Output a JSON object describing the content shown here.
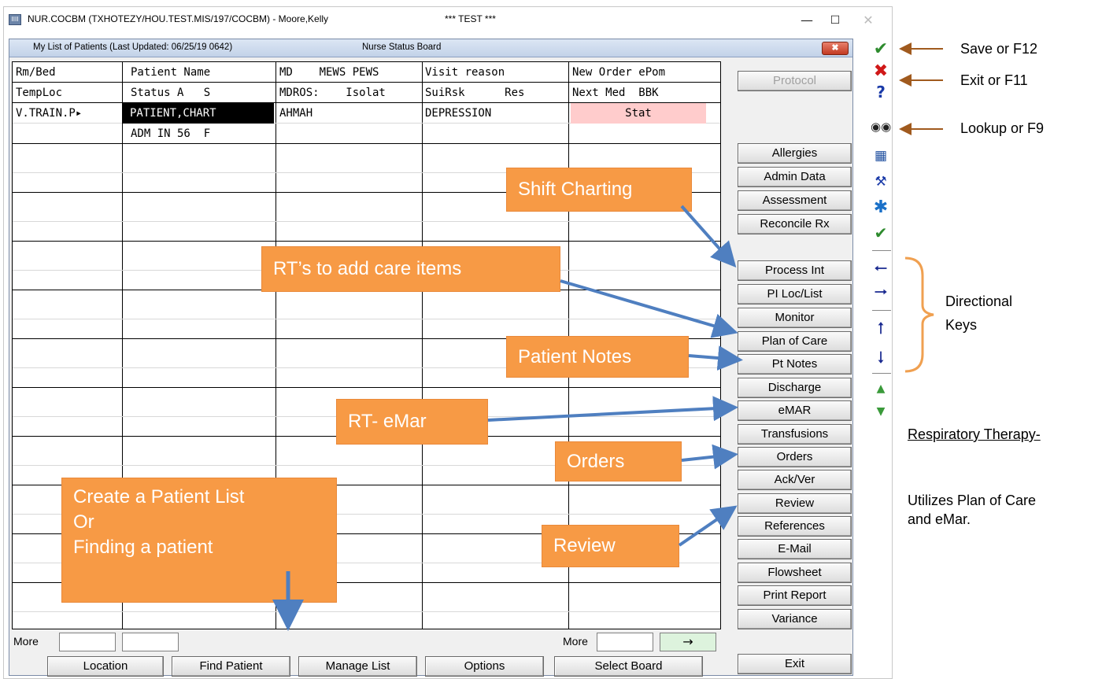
{
  "window": {
    "title": "NUR.COCBM (TXHOTEZY/HOU.TEST.MIS/197/COCBM) - Moore,Kelly",
    "test_banner": "*** TEST ***",
    "app_icon_label": "IIII"
  },
  "board": {
    "list_title": "My List of Patients (Last Updated: 06/25/19  0642)",
    "board_name": "Nurse Status Board"
  },
  "grid": {
    "headers_row1": [
      "Rm/Bed",
      "Patient Name",
      "MD    MEWS PEWS",
      "Visit reason",
      "New Order ePom"
    ],
    "headers_row2": [
      "TempLoc",
      "Status A   S",
      "MDROS:    Isolat",
      "SuiRsk      Res",
      "Next Med  BBK"
    ],
    "patient": {
      "room": "V.TRAIN.P▸",
      "name": "PATIENT,CHART",
      "status": "ADM IN 56  F",
      "md": "AHMAH",
      "visit_reason": "DEPRESSION",
      "new_order": "Stat"
    }
  },
  "more": {
    "label_left": "More",
    "label_right": "More",
    "arrow": "→"
  },
  "side_buttons": [
    {
      "label": "Protocol",
      "disabled": true
    },
    {
      "label": "Allergies"
    },
    {
      "label": "Admin Data"
    },
    {
      "label": "Assessment"
    },
    {
      "label": "Reconcile Rx"
    },
    {
      "label": "Process Int"
    },
    {
      "label": "PI Loc/List"
    },
    {
      "label": "Monitor"
    },
    {
      "label": "Plan of Care"
    },
    {
      "label": "Pt Notes"
    },
    {
      "label": "Discharge"
    },
    {
      "label": "eMAR"
    },
    {
      "label": "Transfusions"
    },
    {
      "label": "Orders"
    },
    {
      "label": "Ack/Ver"
    },
    {
      "label": "Review"
    },
    {
      "label": "References"
    },
    {
      "label": "E-Mail"
    },
    {
      "label": "Flowsheet"
    },
    {
      "label": "Print Report"
    },
    {
      "label": "Variance"
    },
    {
      "label": "Exit"
    }
  ],
  "bottom_buttons": [
    "Location",
    "Find Patient",
    "Manage List",
    "Options",
    "Select Board"
  ],
  "toolbar": {
    "icons": [
      "save-check-icon",
      "exit-x-icon",
      "help-question-icon",
      "lookup-binoculars-icon",
      "calendar-icon",
      "tools-icon",
      "asterisk-icon",
      "check-all-icon",
      "arrow-left-icon",
      "arrow-right-icon",
      "arrow-up-icon",
      "arrow-down-icon",
      "page-up-icon",
      "page-down-icon"
    ]
  },
  "callouts": {
    "shift_charting": "Shift Charting",
    "rt_care_items": "RT’s to add care items",
    "patient_notes": "Patient Notes",
    "rt_emar": "RT- eMar",
    "orders": "Orders",
    "review": "Review",
    "create_list_1": "Create a Patient List",
    "create_list_2": "Or",
    "create_list_3": "Finding a patient"
  },
  "annotations": {
    "save": "Save or F12",
    "exit": "Exit or F11",
    "lookup": "Lookup or F9",
    "directional_1": "Directional",
    "directional_2": "Keys",
    "rt_heading": "Respiratory Therapy-",
    "rt_text_1": "Utilizes Plan of Care",
    "rt_text_2": "and eMar."
  },
  "colors": {
    "callout": "#f79a45",
    "arrow_blue": "#4f7fc0",
    "arrow_brown": "#a05a1e",
    "brace": "#f0a050",
    "stat_cell": "#ffcccc"
  }
}
